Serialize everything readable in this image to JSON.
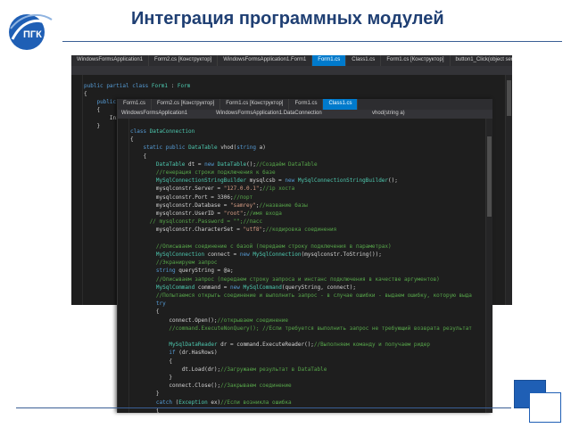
{
  "header": {
    "title": "Интеграция программных модулей",
    "logo_text": "ПГК"
  },
  "win1": {
    "tabs": [
      "WindowsFormsApplication1",
      "Form2.cs [Конструктор]",
      "WindowsFormsApplication1.Form1",
      "Form1.cs",
      "Class1.cs",
      "Form1.cs [Конструктор]",
      "button1_Click(object sender, EventArgs e)"
    ],
    "active_tab_index": 3,
    "lines": [
      "public partial class Form1 : Form",
      "{",
      "    public Form1()",
      "    {",
      "        InitializeComponent();",
      "    }"
    ]
  },
  "win2": {
    "tabs": [
      "Form1.cs",
      "Form2.cs [Конструктор]",
      "Form1.cs [Конструктор]",
      "Form1.cs",
      "Class1.cs"
    ],
    "active_tab_index": 4,
    "nav_left": "WindowsFormsApplication1",
    "nav_mid": "WindowsFormsApplication1.DataConnection",
    "nav_right": "vhod(string a)",
    "lines": [
      "class DataConnection",
      "{",
      "    static public DataTable vhod(string a)",
      "    {",
      "        DataTable dt = new DataTable();//Создаём DataTable",
      "        //генерация строки подключения к базе",
      "        MySqlConnectionStringBuilder mysqlcsb = new MySqlConnectionStringBuilder();",
      "        mysqlconstr.Server = \"127.0.0.1\";//ip хоста",
      "        mysqlconstr.Port = 3306;//порт",
      "        mysqlconstr.Database = \"samrey\";//название базы",
      "        mysqlconstr.UserID = \"root\";//имя входа",
      "      // mysqlconstr.Password = \"\";//пасс",
      "        mysqlconstr.CharacterSet = \"utf8\";//кодировка соединения",
      "",
      "        //Описываем соединение с базой (передаем строку подключения в параметрах)",
      "        MySqlConnection connect = new MySqlConnection(mysqlconstr.ToString());",
      "        //Экранируем запрос",
      "        string queryString = @a;",
      "        //Описываем запрос (передаем строку запроса и инстанс подключения в качестве аргументов)",
      "        MySqlCommand command = new MySqlCommand(queryString, connect);",
      "        //Попытаемся открыть соединение и выполнить запрос - в случае ошибки - выдаем ошибку, которую выда",
      "        try",
      "        {",
      "            connect.Open();//открываем соединение",
      "            //command.ExecuteNonQuery(); //Если требуется выполнить запрос не требующий возврата результат",
      "",
      "            MySqlDataReader dr = command.ExecuteReader();//Выполняем команду и получаем ридер",
      "            if (dr.HasRows)",
      "            {",
      "                dt.Load(dr);//Загружаем результат в DataTable",
      "            }",
      "            connect.Close();//Закрываем соединение",
      "        }",
      "        catch (Exception ex)//Если возникла ошибка",
      "        {"
    ]
  },
  "colors": {
    "title": "#1f3f73",
    "editor_bg": "#1e1e1e",
    "active_tab": "#007acc",
    "keyword": "#569cd6",
    "type": "#4ec9b0",
    "string": "#d69d85",
    "comment": "#57a64a",
    "deco_blue": "#1f5fb5"
  }
}
